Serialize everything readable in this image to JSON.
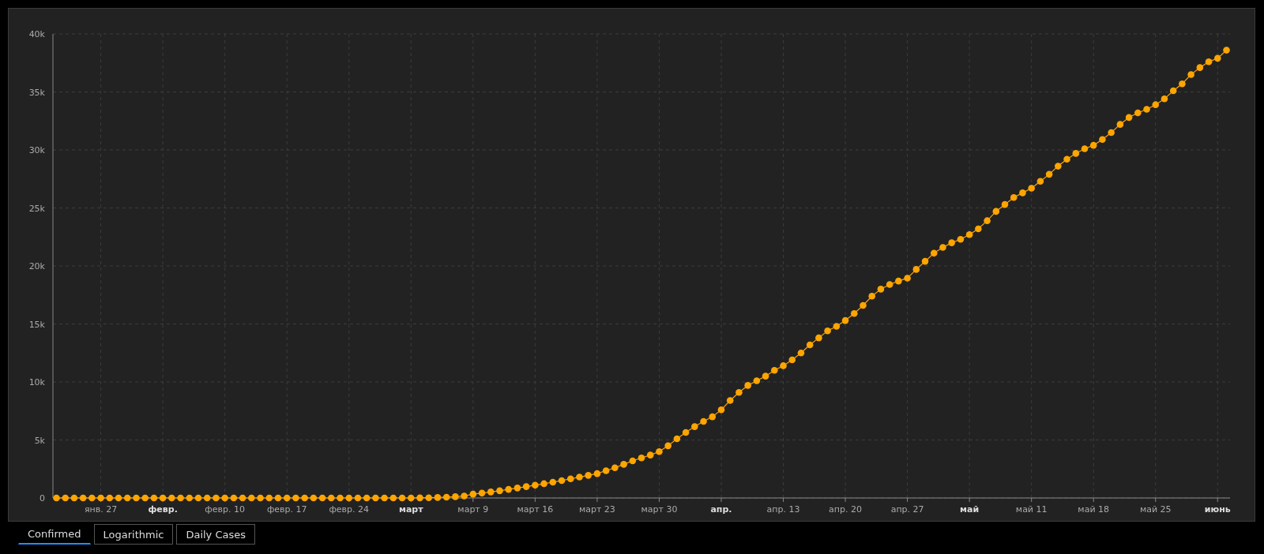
{
  "chart": {
    "chart_data": {
      "type": "line",
      "categories": [
        null,
        null,
        null,
        null,
        null,
        "янв. 27",
        null,
        null,
        null,
        null,
        null,
        null,
        "февр.",
        null,
        null,
        null,
        null,
        null,
        null,
        "февр. 10",
        null,
        null,
        null,
        null,
        null,
        null,
        "февр. 17",
        null,
        null,
        null,
        null,
        null,
        null,
        "февр. 24",
        null,
        null,
        null,
        null,
        null,
        null,
        "март",
        null,
        null,
        null,
        null,
        null,
        null,
        "март 9",
        null,
        null,
        null,
        null,
        null,
        null,
        "март 16",
        null,
        null,
        null,
        null,
        null,
        null,
        "март 23",
        null,
        null,
        null,
        null,
        null,
        null,
        "март 30",
        null,
        null,
        null,
        null,
        null,
        null,
        "апр.",
        null,
        null,
        null,
        null,
        null,
        null,
        "апр. 13",
        null,
        null,
        null,
        null,
        null,
        null,
        "апр. 20",
        null,
        null,
        null,
        null,
        null,
        null,
        "апр. 27",
        null,
        null,
        null,
        null,
        null,
        null,
        "май",
        null,
        null,
        null,
        null,
        null,
        null,
        "май 11",
        null,
        null,
        null,
        null,
        null,
        null,
        "май 18",
        null,
        null,
        null,
        null,
        null,
        null,
        "май 25",
        null,
        null,
        null,
        null,
        null,
        null,
        "июнь",
        null
      ],
      "series": [
        {
          "color": "#ffa500",
          "marker": "circle",
          "values": [
            0,
            0,
            0,
            0,
            0,
            0,
            0,
            0,
            0,
            0,
            0,
            0,
            0,
            0,
            0,
            0,
            0,
            0,
            0,
            0,
            0,
            0,
            0,
            0,
            0,
            0,
            0,
            0,
            0,
            0,
            0,
            0,
            0,
            0,
            0,
            0,
            0,
            0,
            0,
            0,
            0,
            10,
            20,
            40,
            70,
            110,
            170,
            330,
            420,
            520,
            620,
            740,
            860,
            980,
            1100,
            1230,
            1360,
            1500,
            1650,
            1800,
            1950,
            2100,
            2350,
            2600,
            2900,
            3200,
            3450,
            3700,
            4000,
            4500,
            5100,
            5650,
            6150,
            6600,
            7000,
            7600,
            8400,
            9100,
            9700,
            10100,
            10500,
            11000,
            11400,
            11900,
            12500,
            13200,
            13800,
            14400,
            14800,
            15300,
            15900,
            16600,
            17400,
            18000,
            18400,
            18700,
            18950,
            19700,
            20400,
            21100,
            21600,
            22000,
            22300,
            22700,
            23200,
            23900,
            24700,
            25300,
            25900,
            26300,
            26700,
            27300,
            27900,
            28600,
            29200,
            29700,
            30100,
            30400,
            30900,
            31500,
            32200,
            32800,
            33200,
            33500,
            33900,
            34400,
            35100,
            35700,
            36500,
            37100,
            37600,
            37900,
            38600
          ]
        }
      ],
      "ylim": [
        0,
        40000
      ],
      "grid": true,
      "yticks": [
        {
          "value": 0,
          "label": "0"
        },
        {
          "value": 5000,
          "label": "5k"
        },
        {
          "value": 10000,
          "label": "10k"
        },
        {
          "value": 15000,
          "label": "15k"
        },
        {
          "value": 20000,
          "label": "20k"
        },
        {
          "value": 25000,
          "label": "25k"
        },
        {
          "value": 30000,
          "label": "30k"
        },
        {
          "value": 35000,
          "label": "35k"
        },
        {
          "value": 40000,
          "label": "40k"
        }
      ]
    }
  },
  "tabs": [
    {
      "label": "Confirmed",
      "selected": true
    },
    {
      "label": "Logarithmic",
      "selected": false
    },
    {
      "label": "Daily Cases",
      "selected": false
    }
  ]
}
